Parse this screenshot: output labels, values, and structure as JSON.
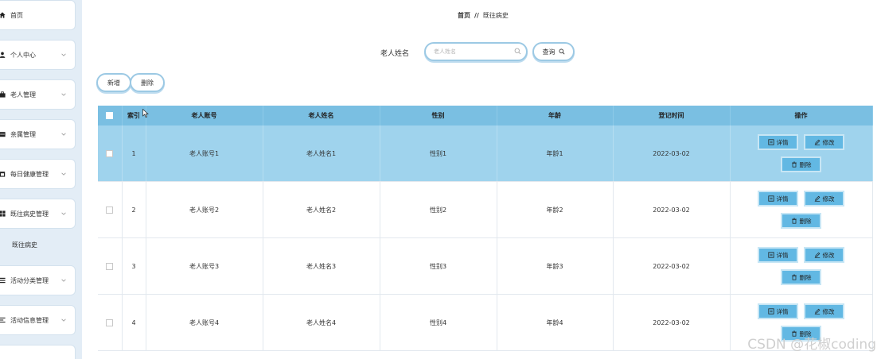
{
  "sidebar": {
    "items": [
      {
        "label": "首页",
        "icon": "home-icon"
      },
      {
        "label": "个人中心",
        "icon": "user-icon"
      },
      {
        "label": "老人管理",
        "icon": "briefcase-icon"
      },
      {
        "label": "亲属管理",
        "icon": "folder-icon"
      },
      {
        "label": "每日健康管理",
        "icon": "calendar-icon"
      },
      {
        "label": "既往病史管理",
        "icon": "grid-icon"
      },
      {
        "label": "活动分类管理",
        "icon": "list-icon"
      },
      {
        "label": "活动信息管理",
        "icon": "align-icon"
      },
      {
        "label": "",
        "icon": ""
      }
    ],
    "active_subitem": "既往病史"
  },
  "breadcrumb": {
    "home": "首页",
    "separator": "//",
    "current": "既往病史"
  },
  "search": {
    "label": "老人姓名",
    "placeholder": "老人姓名",
    "button_label": "查询"
  },
  "actions": {
    "add_label": "新增",
    "delete_label": "删除"
  },
  "table": {
    "headers": [
      "",
      "索引",
      "老人账号",
      "老人姓名",
      "性别",
      "年龄",
      "登记时间",
      "操作"
    ],
    "rows": [
      {
        "index": "1",
        "account": "老人账号1",
        "name": "老人姓名1",
        "gender": "性别1",
        "age": "年龄1",
        "date": "2022-03-02",
        "selected": true
      },
      {
        "index": "2",
        "account": "老人账号2",
        "name": "老人姓名2",
        "gender": "性别2",
        "age": "年龄2",
        "date": "2022-03-02",
        "selected": false
      },
      {
        "index": "3",
        "account": "老人账号3",
        "name": "老人姓名3",
        "gender": "性别3",
        "age": "年龄3",
        "date": "2022-03-02",
        "selected": false
      },
      {
        "index": "4",
        "account": "老人账号4",
        "name": "老人姓名4",
        "gender": "性别4",
        "age": "年龄4",
        "date": "2022-03-02",
        "selected": false
      }
    ],
    "row_ops": {
      "detail": "详情",
      "edit": "修改",
      "delete": "删除"
    }
  },
  "watermark": "CSDN @花椒coding",
  "colors": {
    "header": "#7abfe2",
    "selected_row": "#9fd3ed",
    "op_button": "#62b8e3"
  }
}
